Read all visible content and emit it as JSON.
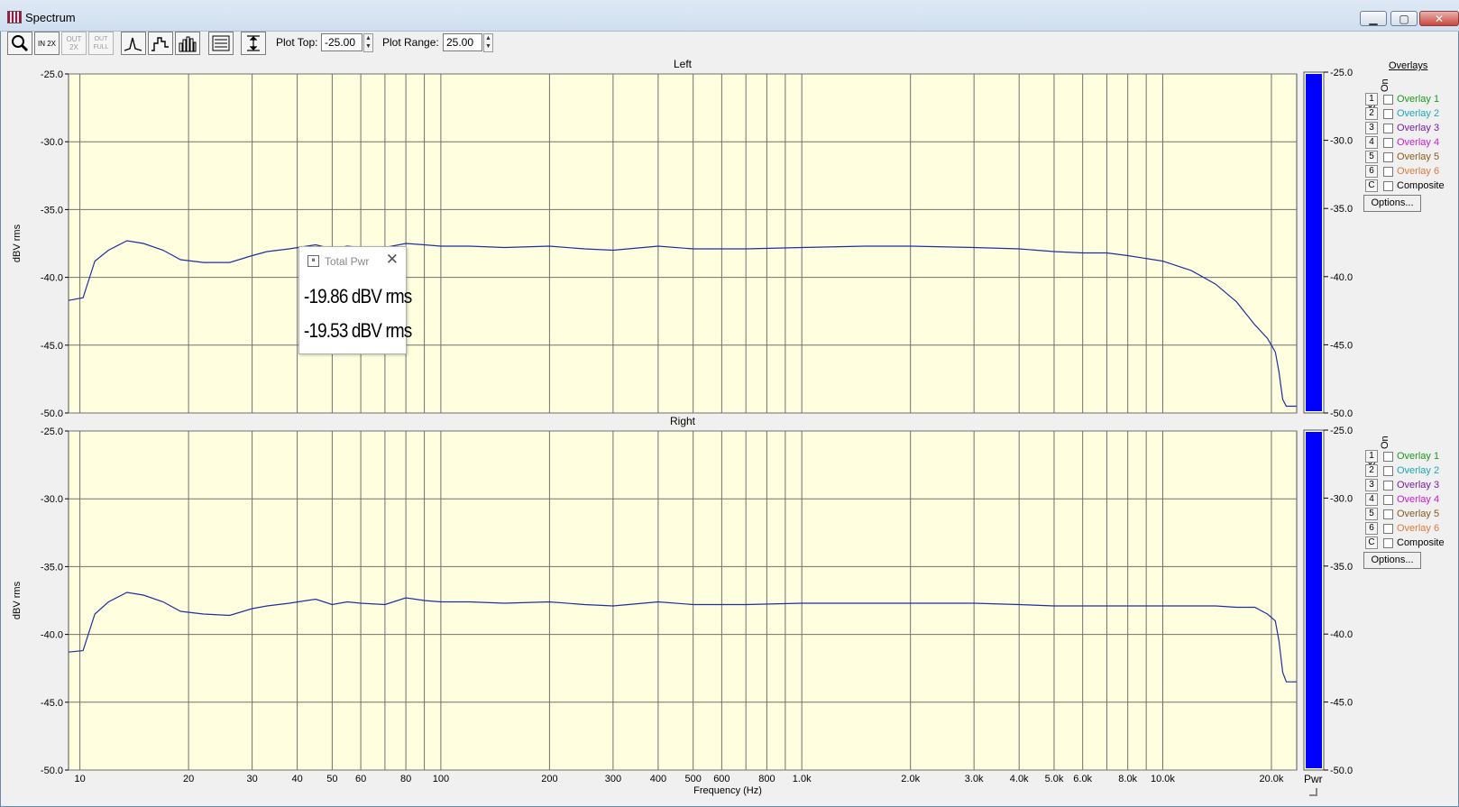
{
  "window": {
    "title": "Spectrum"
  },
  "toolbar": {
    "zoom_label": "",
    "in2x_label": "IN 2X",
    "out2x_label": "OUT 2X",
    "outfull_label": "OUT FULL",
    "plot_top_label": "Plot Top:",
    "plot_top_value": "-25.00",
    "plot_range_label": "Plot Range:",
    "plot_range_value": "25.00"
  },
  "overlays": {
    "title": "Overlays",
    "set_label": "Set",
    "on_label": "On",
    "items": [
      {
        "num": "1",
        "label": "Overlay 1",
        "color": "#1a9b1a"
      },
      {
        "num": "2",
        "label": "Overlay 2",
        "color": "#1aa8b8"
      },
      {
        "num": "3",
        "label": "Overlay 3",
        "color": "#7a1aa8"
      },
      {
        "num": "4",
        "label": "Overlay 4",
        "color": "#d01ad0"
      },
      {
        "num": "5",
        "label": "Overlay 5",
        "color": "#8a5a1a"
      },
      {
        "num": "6",
        "label": "Overlay 6",
        "color": "#e07a3a"
      },
      {
        "num": "C",
        "label": "Composite",
        "color": "#000000"
      }
    ],
    "options_label": "Options..."
  },
  "total_pwr": {
    "title": "Total Pwr",
    "values": [
      "-19.86 dBV rms",
      "-19.53 dBV rms"
    ]
  },
  "pwr_label": "Pwr",
  "chart_data": [
    {
      "type": "line",
      "title": "Left",
      "xlabel": "",
      "ylabel": "dBV rms",
      "x_scale": "log",
      "xlim": [
        9.3,
        23500
      ],
      "ylim": [
        -50,
        -25
      ],
      "yticks": [
        "-25.0",
        "-30.0",
        "-35.0",
        "-40.0",
        "-45.0",
        "-50.0"
      ],
      "xticks": [],
      "grid": true,
      "background": "#ffffe0",
      "line_color": "#1f2fa0",
      "series": [
        {
          "x": [
            9.3,
            10.2,
            11,
            12,
            13.5,
            15,
            17,
            19,
            22,
            26,
            30,
            33,
            38,
            45,
            50,
            55,
            60,
            70,
            80,
            90,
            100,
            120,
            150,
            200,
            250,
            300,
            400,
            500,
            700,
            1000,
            1500,
            2000,
            3000,
            4000,
            5000,
            6000,
            7000,
            8000,
            10000,
            12000,
            14000,
            16000,
            18000,
            19500,
            20500,
            21000,
            21500,
            22000,
            23500
          ],
          "y": [
            -41.7,
            -41.5,
            -38.8,
            -38.0,
            -37.3,
            -37.5,
            -38.0,
            -38.7,
            -38.9,
            -38.9,
            -38.4,
            -38.1,
            -37.9,
            -37.6,
            -37.9,
            -37.7,
            -37.8,
            -37.8,
            -37.5,
            -37.6,
            -37.7,
            -37.7,
            -37.8,
            -37.7,
            -37.9,
            -38.0,
            -37.7,
            -37.9,
            -37.9,
            -37.8,
            -37.7,
            -37.7,
            -37.8,
            -37.9,
            -38.1,
            -38.2,
            -38.2,
            -38.4,
            -38.8,
            -39.5,
            -40.5,
            -41.8,
            -43.5,
            -44.5,
            -45.5,
            -47.0,
            -49.0,
            -49.5,
            -49.5
          ]
        }
      ]
    },
    {
      "type": "line",
      "title": "Right",
      "xlabel": "Frequency (Hz)",
      "ylabel": "dBV rms",
      "x_scale": "log",
      "xlim": [
        9.3,
        23500
      ],
      "ylim": [
        -50,
        -25
      ],
      "yticks": [
        "-25.0",
        "-30.0",
        "-35.0",
        "-40.0",
        "-45.0",
        "-50.0"
      ],
      "xticks": [
        "10",
        "20",
        "30",
        "40",
        "50",
        "60",
        "80",
        "100",
        "200",
        "300",
        "400",
        "500",
        "600",
        "800",
        "1.0k",
        "2.0k",
        "3.0k",
        "4.0k",
        "5.0k",
        "6.0k",
        "8.0k",
        "10.0k",
        "20.0k"
      ],
      "grid": true,
      "background": "#ffffe0",
      "line_color": "#1f2fa0",
      "series": [
        {
          "x": [
            9.3,
            10.2,
            11,
            12,
            13.5,
            15,
            17,
            19,
            22,
            26,
            30,
            33,
            38,
            45,
            50,
            55,
            60,
            70,
            80,
            90,
            100,
            120,
            150,
            200,
            250,
            300,
            400,
            500,
            700,
            1000,
            1500,
            2000,
            3000,
            4000,
            5000,
            6000,
            7000,
            8000,
            10000,
            12000,
            14000,
            16000,
            18000,
            19500,
            20500,
            21000,
            21500,
            22000,
            23500
          ],
          "y": [
            -41.3,
            -41.2,
            -38.5,
            -37.6,
            -36.9,
            -37.1,
            -37.6,
            -38.3,
            -38.5,
            -38.6,
            -38.1,
            -37.9,
            -37.7,
            -37.4,
            -37.8,
            -37.6,
            -37.7,
            -37.8,
            -37.3,
            -37.5,
            -37.6,
            -37.6,
            -37.7,
            -37.6,
            -37.8,
            -37.9,
            -37.6,
            -37.8,
            -37.8,
            -37.7,
            -37.7,
            -37.7,
            -37.7,
            -37.8,
            -37.9,
            -37.9,
            -37.9,
            -37.9,
            -37.9,
            -37.9,
            -37.9,
            -38.0,
            -38.0,
            -38.5,
            -39.0,
            -40.5,
            -42.8,
            -43.5,
            -43.5
          ]
        }
      ]
    }
  ],
  "meters": {
    "fill_color": "#0000ff",
    "ticks": [
      "-25.0",
      "-30.0",
      "-35.0",
      "-40.0",
      "-45.0",
      "-50.0"
    ],
    "levels": [
      1.0,
      1.0
    ]
  }
}
